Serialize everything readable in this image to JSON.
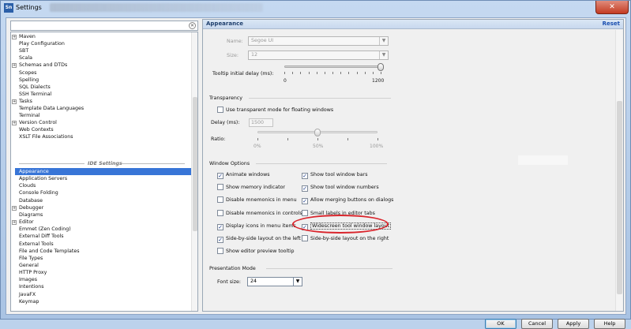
{
  "window": {
    "title": "Settings",
    "close_symbol": "✕",
    "app_icon": "Sn"
  },
  "search": {
    "clear_symbol": "✕",
    "value": ""
  },
  "tree": {
    "items_top": [
      {
        "label": "Maven",
        "expandable": true
      },
      {
        "label": "Play Configuration",
        "expandable": false
      },
      {
        "label": "SBT",
        "expandable": false
      },
      {
        "label": "Scala",
        "expandable": false
      },
      {
        "label": "Schemas and DTDs",
        "expandable": true
      },
      {
        "label": "Scopes",
        "expandable": false
      },
      {
        "label": "Spelling",
        "expandable": false
      },
      {
        "label": "SQL Dialects",
        "expandable": false
      },
      {
        "label": "SSH Terminal",
        "expandable": false
      },
      {
        "label": "Tasks",
        "expandable": true
      },
      {
        "label": "Template Data Languages",
        "expandable": false
      },
      {
        "label": "Terminal",
        "expandable": false
      },
      {
        "label": "Version Control",
        "expandable": true
      },
      {
        "label": "Web Contexts",
        "expandable": false
      },
      {
        "label": "XSLT File Associations",
        "expandable": false
      }
    ],
    "section_label": "IDE Settings",
    "items_bottom": [
      {
        "label": "Appearance",
        "expandable": false,
        "selected": true
      },
      {
        "label": "Application Servers",
        "expandable": false
      },
      {
        "label": "Clouds",
        "expandable": false
      },
      {
        "label": "Console Folding",
        "expandable": false
      },
      {
        "label": "Database",
        "expandable": false
      },
      {
        "label": "Debugger",
        "expandable": true
      },
      {
        "label": "Diagrams",
        "expandable": false
      },
      {
        "label": "Editor",
        "expandable": true
      },
      {
        "label": "Emmet (Zen Coding)",
        "expandable": false
      },
      {
        "label": "External Diff Tools",
        "expandable": false
      },
      {
        "label": "External Tools",
        "expandable": false
      },
      {
        "label": "File and Code Templates",
        "expandable": false
      },
      {
        "label": "File Types",
        "expandable": false
      },
      {
        "label": "General",
        "expandable": false
      },
      {
        "label": "HTTP Proxy",
        "expandable": false
      },
      {
        "label": "Images",
        "expandable": false
      },
      {
        "label": "Intentions",
        "expandable": false
      },
      {
        "label": "JavaFX",
        "expandable": false
      },
      {
        "label": "Keymap",
        "expandable": false
      }
    ]
  },
  "panel": {
    "title": "Appearance",
    "reset": "Reset",
    "name_label": "Name:",
    "name_value": "Segoe UI",
    "size_label": "Size:",
    "size_value": "12",
    "tooltip_label": "Tooltip initial delay (ms):",
    "tooltip_min": "0",
    "tooltip_max": "1200",
    "tooltip_value_fraction": 1.0,
    "transparency_title": "Transparency",
    "transparent_cb": "Use transparent mode for floating windows",
    "delay_label": "Delay (ms):",
    "delay_value": "1500",
    "ratio_label": "Ratio:",
    "ratio_ticks": [
      "0%",
      "50%",
      "100%"
    ],
    "ratio_value_fraction": 0.5,
    "window_options_title": "Window Options",
    "options_left": [
      {
        "label": "Animate windows",
        "checked": true
      },
      {
        "label": "Show memory indicator",
        "checked": false
      },
      {
        "label": "Disable mnemonics in menu",
        "checked": false
      },
      {
        "label": "Disable mnemonics in controls",
        "checked": false
      },
      {
        "label": "Display icons in menu items",
        "checked": true
      },
      {
        "label": "Side-by-side layout on the left",
        "checked": true
      },
      {
        "label": "Show editor preview tooltip",
        "checked": false
      }
    ],
    "options_right": [
      {
        "label": "Show tool window bars",
        "checked": true
      },
      {
        "label": "Show tool window numbers",
        "checked": true
      },
      {
        "label": "Allow merging buttons on dialogs",
        "checked": true
      },
      {
        "label": "Small labels in editor tabs",
        "checked": false
      },
      {
        "label": "Widescreen tool window layout",
        "checked": true
      },
      {
        "label": "Side-by-side layout on the right",
        "checked": false
      }
    ],
    "presentation_title": "Presentation Mode",
    "font_size_label": "Font size:",
    "font_size_value": "24"
  },
  "buttons": {
    "ok": "OK",
    "cancel": "Cancel",
    "apply": "Apply",
    "help": "Help"
  },
  "colors": {
    "selection": "#3875d7",
    "annotation": "#d9262d",
    "reset_link": "#1a4fb0"
  }
}
